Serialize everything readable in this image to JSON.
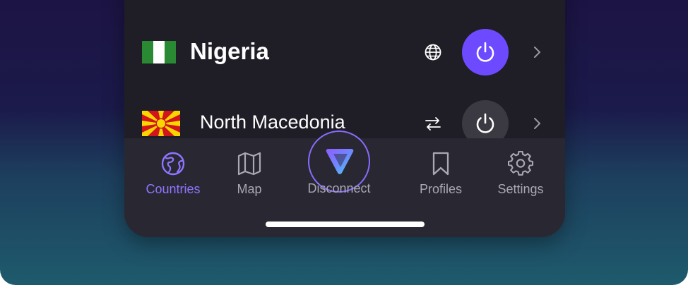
{
  "country_list": {
    "items": [
      {
        "name": "Nigeria",
        "flag": "nigeria-flag",
        "feature_icon": "globe-icon",
        "connected": true,
        "power_icon": "power-icon",
        "chevron_icon": "chevron-right-icon"
      },
      {
        "name": "North Macedonia",
        "flag": "north-macedonia-flag",
        "feature_icon": "p2p-arrows-icon",
        "connected": false,
        "power_icon": "power-icon",
        "chevron_icon": "chevron-right-icon"
      }
    ]
  },
  "tab_bar": {
    "tabs": [
      {
        "label": "Countries",
        "icon": "globe-icon",
        "selected": true
      },
      {
        "label": "Map",
        "icon": "map-icon",
        "selected": false
      },
      {
        "label": "Disconnect",
        "icon": "proton-vpn-logo-icon",
        "selected": false
      },
      {
        "label": "Profiles",
        "icon": "bookmark-icon",
        "selected": false
      },
      {
        "label": "Settings",
        "icon": "gear-icon",
        "selected": false
      }
    ]
  },
  "colors": {
    "accent": "#6d4aff",
    "selected_tab": "#8f75ff",
    "panel_background": "#1f1e26",
    "tab_bar_background": "#292832",
    "idle_power_button": "#3b3a42"
  }
}
